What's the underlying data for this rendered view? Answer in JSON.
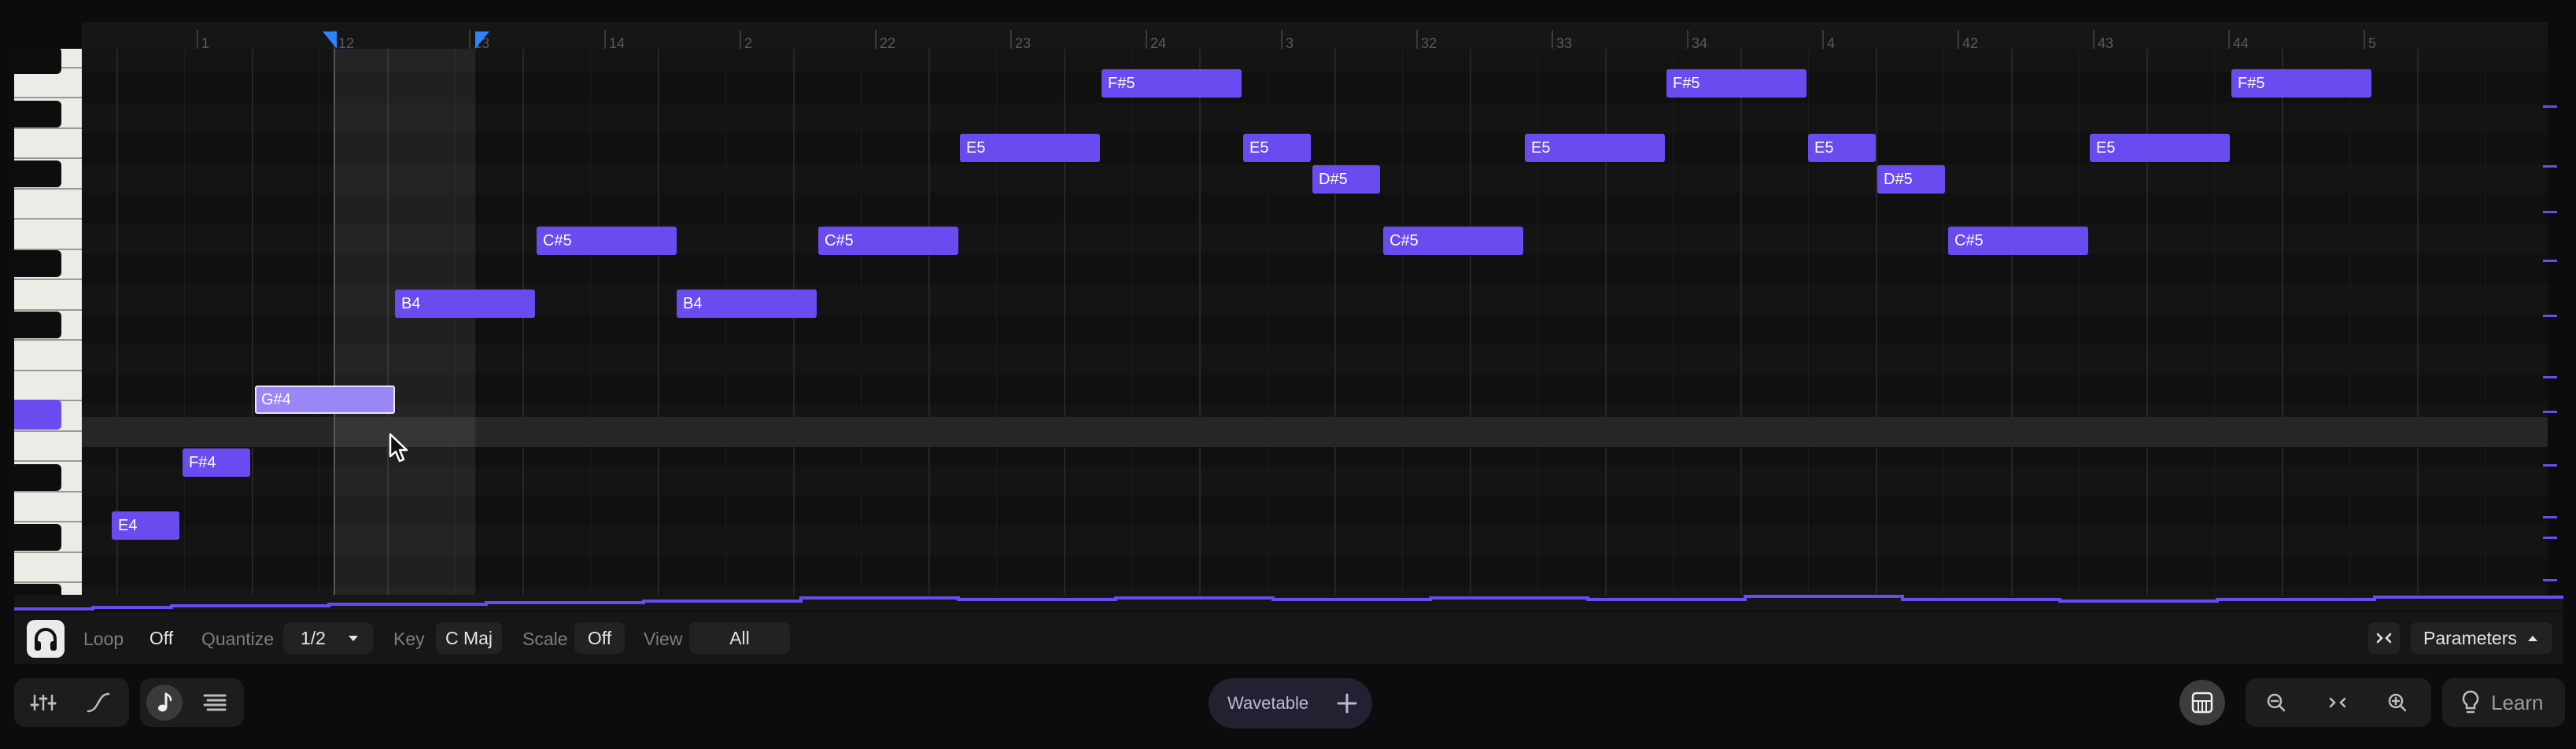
{
  "ruler": {
    "bars": [
      "1",
      "12",
      "13",
      "14",
      "2",
      "22",
      "23",
      "24",
      "3",
      "32",
      "33",
      "34",
      "4",
      "42",
      "43",
      "44",
      "5"
    ]
  },
  "notes": [
    {
      "label": "E4"
    },
    {
      "label": "F#4"
    },
    {
      "label": "G#4"
    },
    {
      "label": "B4"
    },
    {
      "label": "C#5"
    },
    {
      "label": "B4"
    },
    {
      "label": "C#5"
    },
    {
      "label": "E5"
    },
    {
      "label": "F#5"
    },
    {
      "label": "E5"
    },
    {
      "label": "D#5"
    },
    {
      "label": "C#5"
    },
    {
      "label": "E5"
    },
    {
      "label": "F#5"
    },
    {
      "label": "E5"
    },
    {
      "label": "D#5"
    },
    {
      "label": "C#5"
    },
    {
      "label": "E5"
    },
    {
      "label": "F#5"
    }
  ],
  "controls": {
    "loop_label": "Loop",
    "loop_value": "Off",
    "quantize_label": "Quantize",
    "quantize_value": "1/2",
    "key_label": "Key",
    "key_value": "C Maj",
    "scale_label": "Scale",
    "scale_value": "Off",
    "view_label": "View",
    "view_value": "All",
    "parameters_label": "Parameters"
  },
  "bottom": {
    "instrument_label": "Wavetable",
    "learn_label": "Learn"
  },
  "colors": {
    "note": "#6a4bf0",
    "note_selected": "#9b86f7",
    "loop_marker": "#2d84ff",
    "background": "#0c0c0c"
  },
  "icons": {
    "headphones": "headphones-icon",
    "mixer": "sliders-icon",
    "automation": "curve-icon",
    "notes": "music-note-icon",
    "list": "list-icon",
    "add": "plus-icon",
    "instrument": "piano-roll-icon",
    "zoom_out": "zoom-out-icon",
    "fit": "fit-icon",
    "zoom_in": "zoom-in-icon",
    "learn": "lightbulb-icon",
    "collapse": "collapse-icon",
    "dropdown": "caret-down-icon",
    "parameters_caret": "caret-up-icon"
  }
}
